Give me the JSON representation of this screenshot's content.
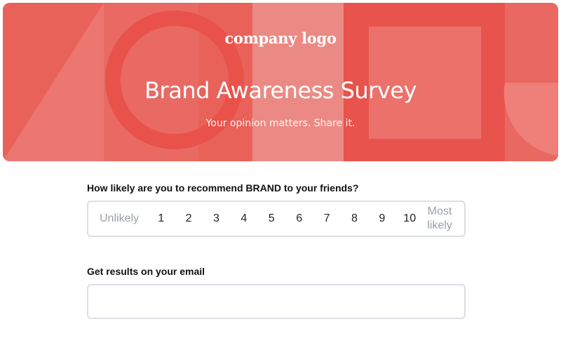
{
  "header": {
    "logo_text": "company logo",
    "title": "Brand Awareness Survey",
    "subtitle": "Your opinion matters. Share it."
  },
  "colors": {
    "hero_background": "#e8625a",
    "accent": "#e8514a"
  },
  "question_nps": {
    "label": "How likely are you to recommend BRAND to your friends?",
    "low_label": "Unlikely",
    "high_label_line1": "Most",
    "high_label_line2": "likely",
    "options": [
      "1",
      "2",
      "3",
      "4",
      "5",
      "6",
      "7",
      "8",
      "9",
      "10"
    ]
  },
  "question_email": {
    "label": "Get results on your email",
    "value": "",
    "placeholder": ""
  }
}
